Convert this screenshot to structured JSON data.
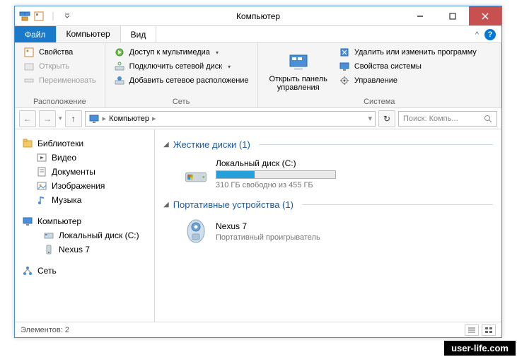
{
  "window": {
    "title": "Компьютер"
  },
  "tabs": {
    "file": "Файл",
    "computer": "Компьютер",
    "view": "Вид"
  },
  "ribbon": {
    "location": {
      "label": "Расположение",
      "properties": "Свойства",
      "open": "Открыть",
      "rename": "Переименовать"
    },
    "network": {
      "label": "Сеть",
      "media": "Доступ к мультимедиа",
      "mapdrive": "Подключить сетевой диск",
      "addloc": "Добавить сетевое расположение"
    },
    "controlpanel": {
      "title_l1": "Открыть панель",
      "title_l2": "управления"
    },
    "system": {
      "label": "Система",
      "uninstall": "Удалить или изменить программу",
      "sysprops": "Свойства системы",
      "manage": "Управление"
    }
  },
  "nav": {
    "up_tooltip": "Up",
    "refresh_tooltip": "Refresh"
  },
  "address": {
    "root": "Компьютер"
  },
  "search": {
    "placeholder": "Поиск: Компь..."
  },
  "tree": {
    "libraries": "Библиотеки",
    "videos": "Видео",
    "documents": "Документы",
    "pictures": "Изображения",
    "music": "Музыка",
    "computer": "Компьютер",
    "localdisk": "Локальный диск (C:)",
    "nexus7": "Nexus 7",
    "network": "Сеть"
  },
  "groups": {
    "hdd": {
      "title": "Жесткие диски (1)"
    },
    "portable": {
      "title": "Портативные устройства (1)"
    }
  },
  "drive": {
    "name": "Локальный диск (C:)",
    "free_text": "310 ГБ свободно из 455 ГБ",
    "fill_percent": 32
  },
  "device": {
    "name": "Nexus 7",
    "sub": "Портативный проигрыватель"
  },
  "status": {
    "items": "Элементов: 2"
  },
  "watermark": "user-life.com"
}
